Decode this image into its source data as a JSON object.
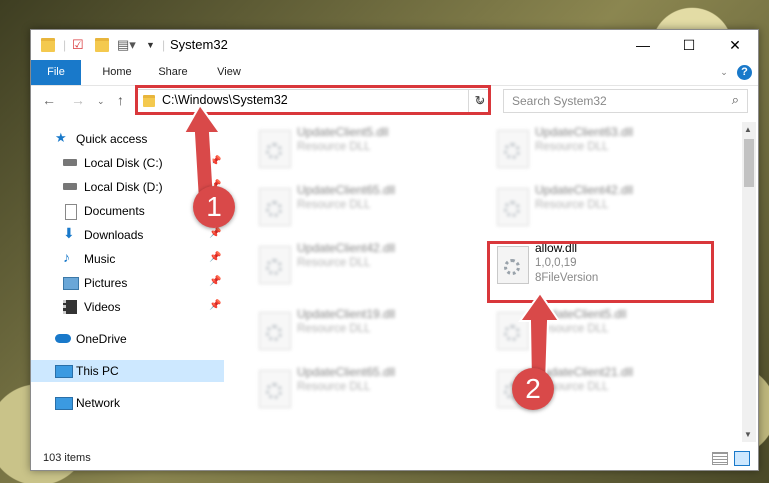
{
  "window": {
    "title": "System32",
    "minimize": "—",
    "maximize": "☐",
    "close": "✕"
  },
  "ribbon": {
    "tabs": [
      "File",
      "Home",
      "Share",
      "View"
    ],
    "help": "?"
  },
  "address": {
    "path": "C:\\Windows\\System32"
  },
  "search": {
    "placeholder": "Search System32"
  },
  "sidebar": {
    "items": [
      {
        "label": "Quick access"
      },
      {
        "label": "Local Disk (C:)"
      },
      {
        "label": "Local Disk (D:)"
      },
      {
        "label": "Documents"
      },
      {
        "label": "Downloads"
      },
      {
        "label": "Music"
      },
      {
        "label": "Pictures"
      },
      {
        "label": "Videos"
      },
      {
        "label": "OneDrive"
      },
      {
        "label": "This PC"
      },
      {
        "label": "Network"
      }
    ]
  },
  "files": [
    {
      "name": "UpdateClient5.dll",
      "type": "Resource DLL"
    },
    {
      "name": "UpdateClient63.dll",
      "type": "Resource DLL"
    },
    {
      "name": "UpdateClient65.dll",
      "type": "Resource DLL"
    },
    {
      "name": "UpdateClient42.dll",
      "type": "Resource DLL"
    },
    {
      "name": "UpdateClient42.dll",
      "type": "Resource DLL"
    },
    {
      "name": "allow.dll",
      "type": "1,0,0,19",
      "version": "8FileVersion"
    },
    {
      "name": "UpdateClient19.dll",
      "type": "Resource DLL"
    },
    {
      "name": "UpdateClient5.dll",
      "type": "Resource DLL"
    },
    {
      "name": "UpdateClient65.dll",
      "type": "Resource DLL"
    },
    {
      "name": "UpdateClient21.dll",
      "type": "Resource DLL"
    }
  ],
  "status": {
    "count": "103 items"
  },
  "annotations": {
    "step1": "1",
    "step2": "2"
  },
  "colors": {
    "accent": "#1979ca",
    "highlight": "#d9373b",
    "badge": "#d94949"
  }
}
